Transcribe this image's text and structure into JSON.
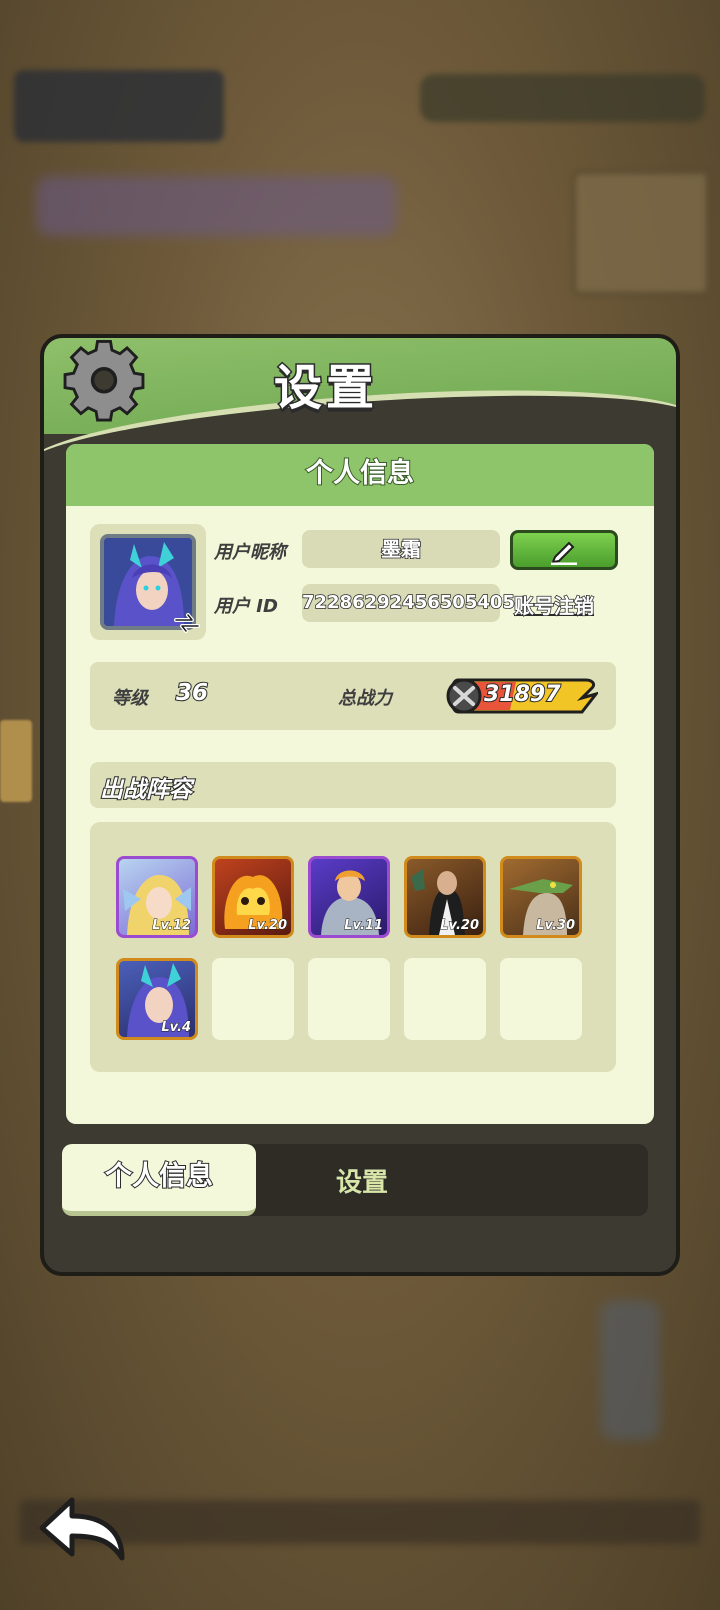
{
  "panel": {
    "title": "设置"
  },
  "card": {
    "header": "个人信息"
  },
  "profile": {
    "nickname_label": "用户昵称",
    "nickname": "墨霜",
    "id_label": "用户 ID",
    "user_id": "72286292456505405",
    "logout_link": "账号注销"
  },
  "stats": {
    "level_label": "等级",
    "level": "36",
    "power_label": "总战力",
    "power": "31897"
  },
  "lineup": {
    "title": "出战阵容",
    "heroes": [
      {
        "lv": "Lv.12",
        "frame": "purple"
      },
      {
        "lv": "Lv.20",
        "frame": "orange"
      },
      {
        "lv": "Lv.11",
        "frame": "purple"
      },
      {
        "lv": "Lv.20",
        "frame": "orange"
      },
      {
        "lv": "Lv.30",
        "frame": "orange"
      },
      {
        "lv": "Lv.4",
        "frame": "orange"
      }
    ]
  },
  "tabs": {
    "profile": "个人信息",
    "settings": "设置"
  },
  "colors": {
    "accent_green": "#8fc56a",
    "panel_dark": "#3c3a31",
    "card_light": "#f3f8da"
  }
}
